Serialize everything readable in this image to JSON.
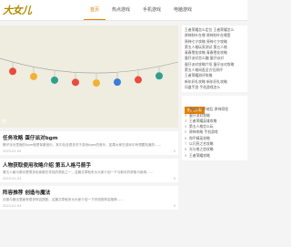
{
  "site": {
    "logo_text": "大女儿"
  },
  "nav": {
    "items": [
      "首页",
      "热点游戏",
      "手机游戏",
      "电脑游戏"
    ],
    "active_index": 0
  },
  "banner": {
    "caption": "阿"
  },
  "articles": [
    {
      "title": "任务攻略 蛋仔派对bgm",
      "text": "蛋仔派对里面的bgm就是背景音乐，其中包含很多关于游戏bgm的音乐，如果大家在游戏中有想要知道的……",
      "date": "2023-01-04",
      "views": "0"
    },
    {
      "title": "人物获取使用攻略介绍 第五人格弓箭手",
      "text": "第五人格弓箭手是很多玩家都在寻找的角色之一，这篇文章就来为大家介绍一下弓箭手的获取与使用……",
      "date": "2023-01-04",
      "views": "0"
    },
    {
      "title": "阵容推荐 创造与魔法",
      "text": "创造与魔法里面有很多阵容搭配，这篇文章就来为大家介绍一下好用的阵容推荐……",
      "date": "2023-01-04",
      "views": "0"
    }
  ],
  "sidebar": {
    "list1": [
      "王者荣耀怎么定位 王者荣耀怎么",
      "原神秋叶在哪 原神秋叶在哪里",
      "原神七夕攻略 原神七夕攻略",
      "第五人格玩家测试 第五人格",
      "青春雪花攻略 青春雪花攻略",
      "蛋仔派对怎么蹦 蛋仔派对",
      "蛋仔派对攻略介绍 蛋仔派对攻略",
      "第五人格闲逛全方位测评",
      "王者荣耀测评攻略",
      "新年好礼攻略 新年好礼攻略",
      "问道手游 手机游戏怎么"
    ],
    "hot_tag": "热门文章",
    "list2": [
      "原神什么不能乱 原神奇怪",
      "蛋仔派对攻略",
      "王者荣耀英雄攻略",
      "第五人格怎么玩",
      "原神攻略 手机游戏",
      "和平精英攻略",
      "以闪亮之名攻略",
      "光与夜之恋攻略",
      "王者荣耀攻略"
    ]
  }
}
